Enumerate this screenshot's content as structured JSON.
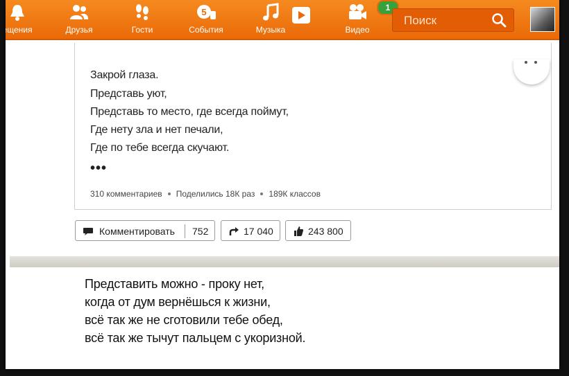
{
  "nav": {
    "items": [
      {
        "label": "ещения",
        "icon": "bell-icon"
      },
      {
        "label": "Друзья",
        "icon": "friends-icon"
      },
      {
        "label": "Гости",
        "icon": "footprints-icon"
      },
      {
        "label": "События",
        "icon": "events-icon"
      },
      {
        "label": "Музыка",
        "icon": "music-note-icon"
      },
      {
        "label": "",
        "icon": "play-video-icon"
      },
      {
        "label": "Видео",
        "icon": "video-camera-icon"
      }
    ],
    "video_badge": "1",
    "search_placeholder": "Поиск",
    "accent_color": "#ee6f0b"
  },
  "post": {
    "lines": [
      "Закрой глаза.",
      "Представь уют,",
      "Представь то место, где всегда поймут,",
      "Где нету зла и нет печали,",
      "Где по тебе всегда скучают."
    ],
    "ellipsis": "•••",
    "stats": {
      "comments": "310 комментариев",
      "shares": "Поделились 18К раз",
      "classes": "189К классов"
    }
  },
  "actions": {
    "comment_label": "Комментировать",
    "comment_count": "752",
    "share_count": "17 040",
    "like_count": "243 800"
  },
  "next_post": {
    "lines": [
      "Представить можно - проку нет,",
      "когда от дум вернёшься к жизни,",
      "всё так же не сготовили тебе обед,",
      "всё так же тычут пальцем с укоризной."
    ]
  }
}
